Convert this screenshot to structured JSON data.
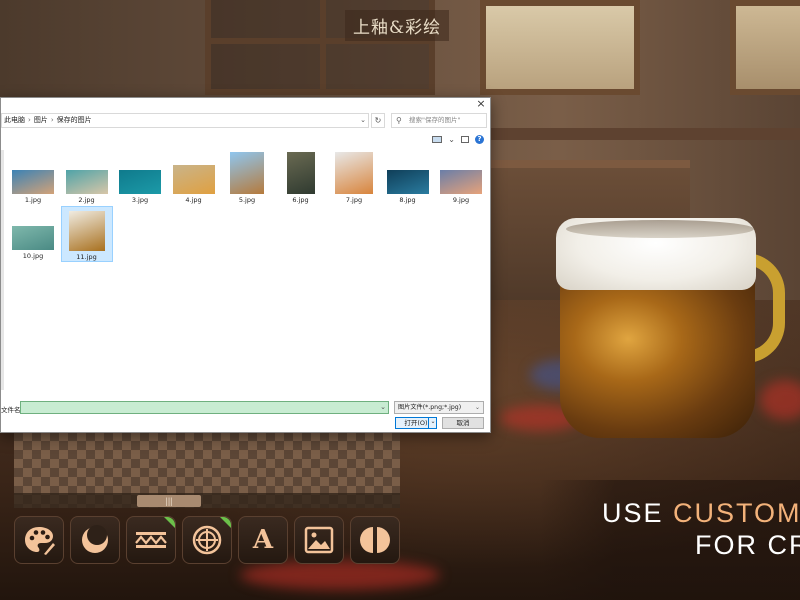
{
  "app": {
    "title": "上釉&彩绘"
  },
  "dialog": {
    "close_glyph": "×",
    "breadcrumb": [
      "此电脑",
      "图片",
      "保存的图片"
    ],
    "breadcrumb_sep": "›",
    "refresh_glyph": "↻",
    "dropdown_glyph": "⌄",
    "search_placeholder": "搜索\"保存的图片\"",
    "help_glyph": "?",
    "files": [
      {
        "name": "1.jpg",
        "colors": [
          "#3b82b5",
          "#d3a278"
        ],
        "selected": false
      },
      {
        "name": "2.jpg",
        "colors": [
          "#4fa3a8",
          "#d8c6a8"
        ],
        "selected": false
      },
      {
        "name": "3.jpg",
        "colors": [
          "#0f7a8c",
          "#1c9aa8"
        ],
        "selected": false
      },
      {
        "name": "4.jpg",
        "colors": [
          "#c9b48a",
          "#e0a040"
        ],
        "selected": false
      },
      {
        "name": "5.jpg",
        "colors": [
          "#8fc6ef",
          "#b57a3c"
        ],
        "selected": false
      },
      {
        "name": "6.jpg",
        "colors": [
          "#6a6a52",
          "#2f3a30"
        ],
        "selected": false
      },
      {
        "name": "7.jpg",
        "colors": [
          "#e8e8e8",
          "#d8843c"
        ],
        "selected": false
      },
      {
        "name": "8.jpg",
        "colors": [
          "#0f3e58",
          "#2a7ca0"
        ],
        "selected": false
      },
      {
        "name": "9.jpg",
        "colors": [
          "#6a7ea8",
          "#e7a27a"
        ],
        "selected": false
      },
      {
        "name": "10.jpg",
        "colors": [
          "#7fb8ac",
          "#4a8a84"
        ],
        "selected": false
      },
      {
        "name": "11.jpg",
        "colors": [
          "#f0ece2",
          "#a8701e"
        ],
        "selected": true
      }
    ],
    "filename_label": "文件名(N):",
    "filename_value": "",
    "filter_label": "图片文件(*.png;*.jpg)",
    "open_label": "打开(O)",
    "cancel_label": "取消"
  },
  "canvas": {
    "scroll_thumb_label": "|||"
  },
  "toolbar": {
    "tools": [
      {
        "name": "palette",
        "icon": "palette-icon",
        "new": false
      },
      {
        "name": "moon",
        "icon": "crescent-moon-icon",
        "new": false
      },
      {
        "name": "pattern",
        "icon": "pattern-band-icon",
        "new": true
      },
      {
        "name": "emblem",
        "icon": "emblem-icon",
        "new": true
      },
      {
        "name": "text",
        "icon": "text-icon",
        "label": "A",
        "new": false
      },
      {
        "name": "image",
        "icon": "image-icon",
        "new": false
      },
      {
        "name": "split",
        "icon": "half-circle-icon",
        "new": false
      }
    ]
  },
  "promo": {
    "line1_prefix": "USE ",
    "line1_highlight": "CUSTOM P",
    "line2": "FOR CRE"
  },
  "colors": {
    "accent": "#f3c39a",
    "highlight": "#f3b27a",
    "new_badge": "#6cc04a",
    "selection": "#cce8ff"
  }
}
